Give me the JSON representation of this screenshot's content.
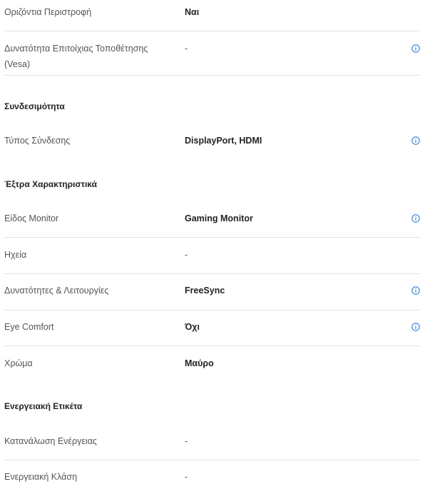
{
  "rows": {
    "horizontal_rotation": {
      "label": "Οριζόντια Περιστροφή",
      "value": "Ναι"
    },
    "vesa": {
      "label": "Δυνατότητα Επιτοίχιας Τοποθέτησης (Vesa)",
      "value": "-"
    },
    "connection_type": {
      "label": "Τύπος Σύνδεσης",
      "value": "DisplayPort, HDMI"
    },
    "monitor_type": {
      "label": "Είδος Monitor",
      "value": "Gaming Monitor"
    },
    "speakers": {
      "label": "Ηχεία",
      "value": "-"
    },
    "features": {
      "label": "Δυνατότητες & Λειτουργίες",
      "value": "FreeSync"
    },
    "eye_comfort": {
      "label": "Eye Comfort",
      "value": "Όχι"
    },
    "color": {
      "label": "Χρώμα",
      "value": "Μαύρο"
    },
    "power_consumption": {
      "label": "Κατανάλωση Ενέργειας",
      "value": "-"
    },
    "energy_class": {
      "label": "Ενεργειακή Κλάση",
      "value": "-"
    }
  },
  "sections": {
    "connectivity": "Συνδεσιμότητα",
    "extra_features": "Έξτρα Χαρακτηριστικά",
    "energy_label": "Ενεργειακή Ετικέτα"
  },
  "icons": {
    "info": "info-circle-icon"
  },
  "colors": {
    "info_icon": "#1a6fd4",
    "divider": "#e2e2e2"
  }
}
